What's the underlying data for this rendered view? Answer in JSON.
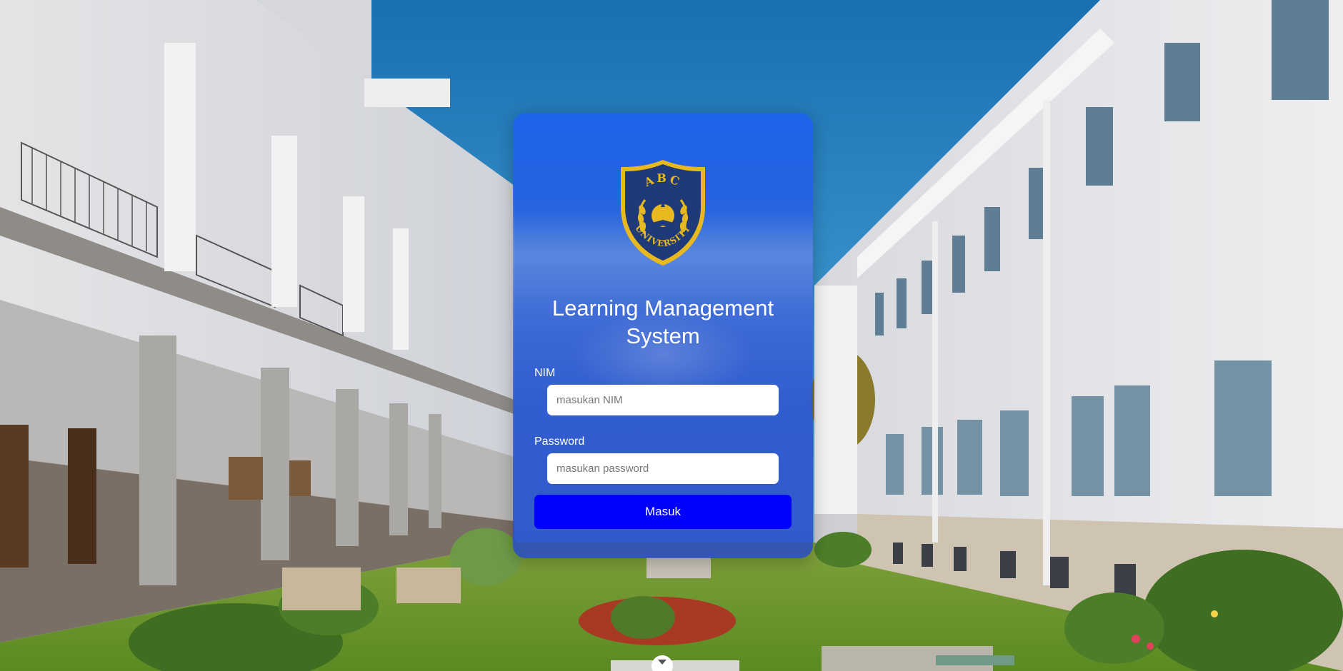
{
  "page": {
    "title": "Learning Management System"
  },
  "logo": {
    "top_text": "ABC",
    "bottom_text": "UNIVERSITY",
    "colors": {
      "shield": "#1e3a78",
      "gold": "#e8b820"
    }
  },
  "form": {
    "nim_label": "NIM",
    "nim_placeholder": "masukan NIM",
    "password_label": "Password",
    "password_placeholder": "masukan password",
    "submit_label": "Masuk"
  },
  "colors": {
    "card": "#2563eb",
    "button": "#0000ff",
    "text": "#ffffff"
  },
  "icons": {
    "scroll": "chevron-down-icon"
  }
}
